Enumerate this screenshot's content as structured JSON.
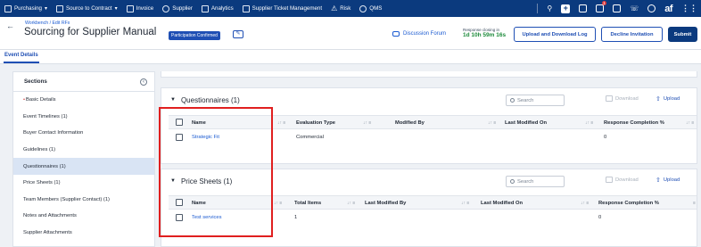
{
  "topnav": {
    "items": [
      {
        "label": "Purchasing",
        "dropdown": true,
        "icon": "document-icon"
      },
      {
        "label": "Source to Contract",
        "dropdown": true,
        "icon": "square-icon"
      },
      {
        "label": "Invoice",
        "dropdown": false,
        "icon": "invoice-icon"
      },
      {
        "label": "Supplier",
        "dropdown": false,
        "icon": "supplier-icon"
      },
      {
        "label": "Analytics",
        "dropdown": false,
        "icon": "analytics-icon"
      },
      {
        "label": "Supplier Ticket Management",
        "dropdown": false,
        "icon": "ticket-icon"
      },
      {
        "label": "Risk",
        "dropdown": false,
        "icon": "warning-icon"
      },
      {
        "label": "QMS",
        "dropdown": false,
        "icon": "qms-icon"
      }
    ],
    "notification_count": "1",
    "logo_text": "af"
  },
  "header": {
    "breadcrumb": "Workbench / Edit RFx",
    "title": "Sourcing for Supplier Manual",
    "status_badge": "Participation Confirmed",
    "discussion_forum": "Discussion Forum",
    "closing_label": "Response closing in",
    "closing_time": "1d 10h 59m 16s",
    "btn_upload_log": "Upload and Download Log",
    "btn_decline": "Decline Invitation",
    "btn_submit": "Submit"
  },
  "tabs": {
    "active": "Event Details"
  },
  "sidebar": {
    "heading": "Sections",
    "items": [
      {
        "label": "Basic Details",
        "required": true,
        "active": false
      },
      {
        "label": "Event Timelines (1)",
        "required": false,
        "active": false
      },
      {
        "label": "Buyer Contact Information",
        "required": false,
        "active": false
      },
      {
        "label": "Guidelines (1)",
        "required": false,
        "active": false
      },
      {
        "label": "Questionnaires (1)",
        "required": false,
        "active": true
      },
      {
        "label": "Price Sheets (1)",
        "required": false,
        "active": false
      },
      {
        "label": "Team Members (Supplier Contact) (1)",
        "required": false,
        "active": false
      },
      {
        "label": "Notes and Attachments",
        "required": false,
        "active": false
      },
      {
        "label": "Supplier Attachments",
        "required": false,
        "active": false
      }
    ]
  },
  "questionnaires": {
    "title": "Questionnaires (1)",
    "search_placeholder": "Search",
    "download": "Download",
    "upload": "Upload",
    "columns": [
      "Name",
      "Evaluation Type",
      "Modified By",
      "Last Modified On",
      "Response Completion %"
    ],
    "rows": [
      {
        "name": "Strategic Fit",
        "evaluation_type": "Commercial",
        "modified_by": "",
        "last_modified_on": "",
        "completion": "0"
      }
    ]
  },
  "price_sheets": {
    "title": "Price Sheets (1)",
    "search_placeholder": "Search",
    "download": "Download",
    "upload": "Upload",
    "columns": [
      "Name",
      "Total Items",
      "Last Modified By",
      "Last Modified On",
      "Response Completion %"
    ],
    "rows": [
      {
        "name": "Test services",
        "total_items": "1",
        "last_modified_by": "",
        "last_modified_on": "",
        "completion": "0"
      }
    ]
  }
}
